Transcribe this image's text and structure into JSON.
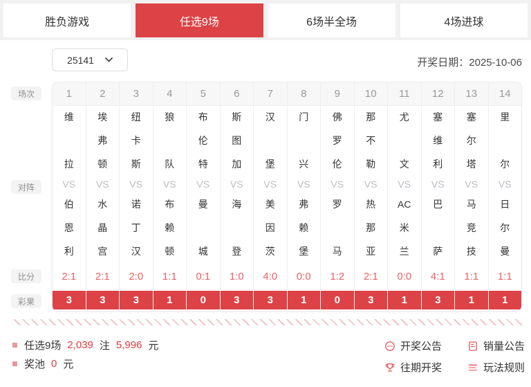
{
  "colors": {
    "accent": "#dd4246",
    "score_red": "#ef5e63",
    "amount_red": "#e4393c",
    "icon_red": "#e4575b",
    "bullet": "#e59a9c"
  },
  "tabs": [
    {
      "label": "胜负游戏",
      "active": false
    },
    {
      "label": "任选9场",
      "active": true
    },
    {
      "label": "6场半全场",
      "active": false
    },
    {
      "label": "4场进球",
      "active": false
    }
  ],
  "period": {
    "value": "25141"
  },
  "draw_date": "开奖日期：2025-10-06",
  "row_labels": {
    "match_no": "场次",
    "versus": "对阵",
    "score": "比分",
    "result": "彩果"
  },
  "vs_label": "VS",
  "matches": [
    {
      "no": "1",
      "home": [
        "维",
        "拉"
      ],
      "away": [
        "伯",
        "恩",
        "利"
      ],
      "score": "2:1",
      "result": "3"
    },
    {
      "no": "2",
      "home": [
        "埃",
        "弗",
        "顿"
      ],
      "away": [
        "水",
        "晶",
        "宫"
      ],
      "score": "2:1",
      "result": "3"
    },
    {
      "no": "3",
      "home": [
        "纽",
        "卡",
        "斯"
      ],
      "away": [
        "诺",
        "丁",
        "汉"
      ],
      "score": "2:0",
      "result": "3"
    },
    {
      "no": "4",
      "home": [
        "狼",
        "队"
      ],
      "away": [
        "布",
        "赖",
        "顿"
      ],
      "score": "1:1",
      "result": "1"
    },
    {
      "no": "5",
      "home": [
        "布",
        "伦",
        "特"
      ],
      "away": [
        "曼",
        "城"
      ],
      "score": "0:1",
      "result": "0"
    },
    {
      "no": "6",
      "home": [
        "斯",
        "图",
        "加"
      ],
      "away": [
        "海",
        "登"
      ],
      "score": "1:0",
      "result": "3"
    },
    {
      "no": "7",
      "home": [
        "汉",
        "堡"
      ],
      "away": [
        "美",
        "因",
        "茨"
      ],
      "score": "4:0",
      "result": "3"
    },
    {
      "no": "8",
      "home": [
        "门",
        "兴"
      ],
      "away": [
        "弗",
        "赖",
        "堡"
      ],
      "score": "0:0",
      "result": "1"
    },
    {
      "no": "9",
      "home": [
        "佛",
        "罗",
        "伦"
      ],
      "away": [
        "罗",
        "马"
      ],
      "score": "1:2",
      "result": "0"
    },
    {
      "no": "10",
      "home": [
        "那",
        "不",
        "勒"
      ],
      "away": [
        "热",
        "那",
        "亚"
      ],
      "score": "2:1",
      "result": "3"
    },
    {
      "no": "11",
      "home": [
        "尤",
        "文"
      ],
      "away": [
        "AC",
        "米",
        "兰"
      ],
      "score": "0:0",
      "result": "1"
    },
    {
      "no": "12",
      "home": [
        "塞",
        "维",
        "利"
      ],
      "away": [
        "巴",
        "萨"
      ],
      "score": "4:1",
      "result": "3"
    },
    {
      "no": "13",
      "home": [
        "塞",
        "尔",
        "塔"
      ],
      "away": [
        "马",
        "竞",
        "技"
      ],
      "score": "1:1",
      "result": "1"
    },
    {
      "no": "14",
      "home": [
        "里",
        "尔"
      ],
      "away": [
        "日",
        "尔",
        "曼"
      ],
      "score": "1:1",
      "result": "1"
    }
  ],
  "summary": [
    {
      "segments": [
        {
          "t": "任选9场",
          "red": false
        },
        {
          "t": "2,039",
          "red": true
        },
        {
          "t": "注",
          "red": false
        },
        {
          "t": "5,996",
          "red": true
        },
        {
          "t": "元",
          "red": false
        }
      ]
    },
    {
      "segments": [
        {
          "t": "奖池",
          "red": false
        },
        {
          "t": "0",
          "red": true
        },
        {
          "t": "元",
          "red": false
        }
      ]
    }
  ],
  "links": [
    {
      "icon": "announcement-icon",
      "label": "开奖公告"
    },
    {
      "icon": "sales-report-icon",
      "label": "销量公告"
    },
    {
      "icon": "trophy-icon",
      "label": "往期开奖"
    },
    {
      "icon": "rules-icon",
      "label": "玩法规则"
    }
  ]
}
